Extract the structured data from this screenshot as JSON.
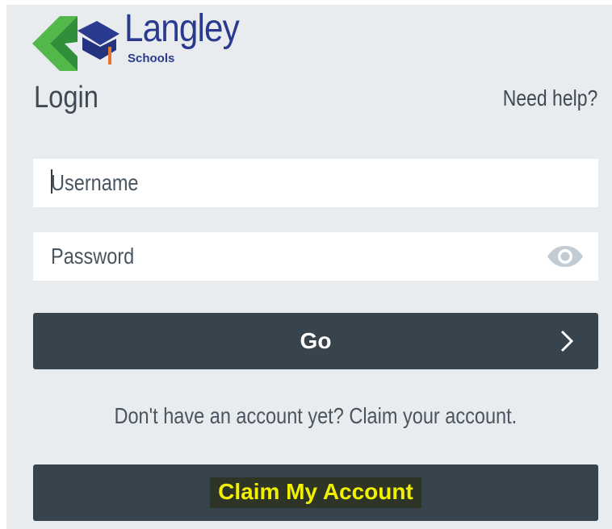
{
  "brand": {
    "name": "Langley",
    "subtitle": "Schools",
    "colors": {
      "green": "#52b84a",
      "dark_green": "#2f8f3a",
      "navy": "#2a3a8f",
      "orange": "#e8742a"
    }
  },
  "header": {
    "title": "Login",
    "help_link": "Need help?"
  },
  "form": {
    "username": {
      "value": "",
      "placeholder": "Username"
    },
    "password": {
      "value": "",
      "placeholder": "Password",
      "toggle_icon": "eye-icon"
    },
    "submit_label": "Go",
    "submit_icon": "chevron-right-icon"
  },
  "claim": {
    "prompt": "Don't have an account yet? Claim your account.",
    "button_label": "Claim My Account"
  },
  "colors": {
    "panel_bg": "#e9ecef",
    "button_bg": "#37444d",
    "claim_label_text": "#f0f000",
    "text": "#3f4a54"
  }
}
